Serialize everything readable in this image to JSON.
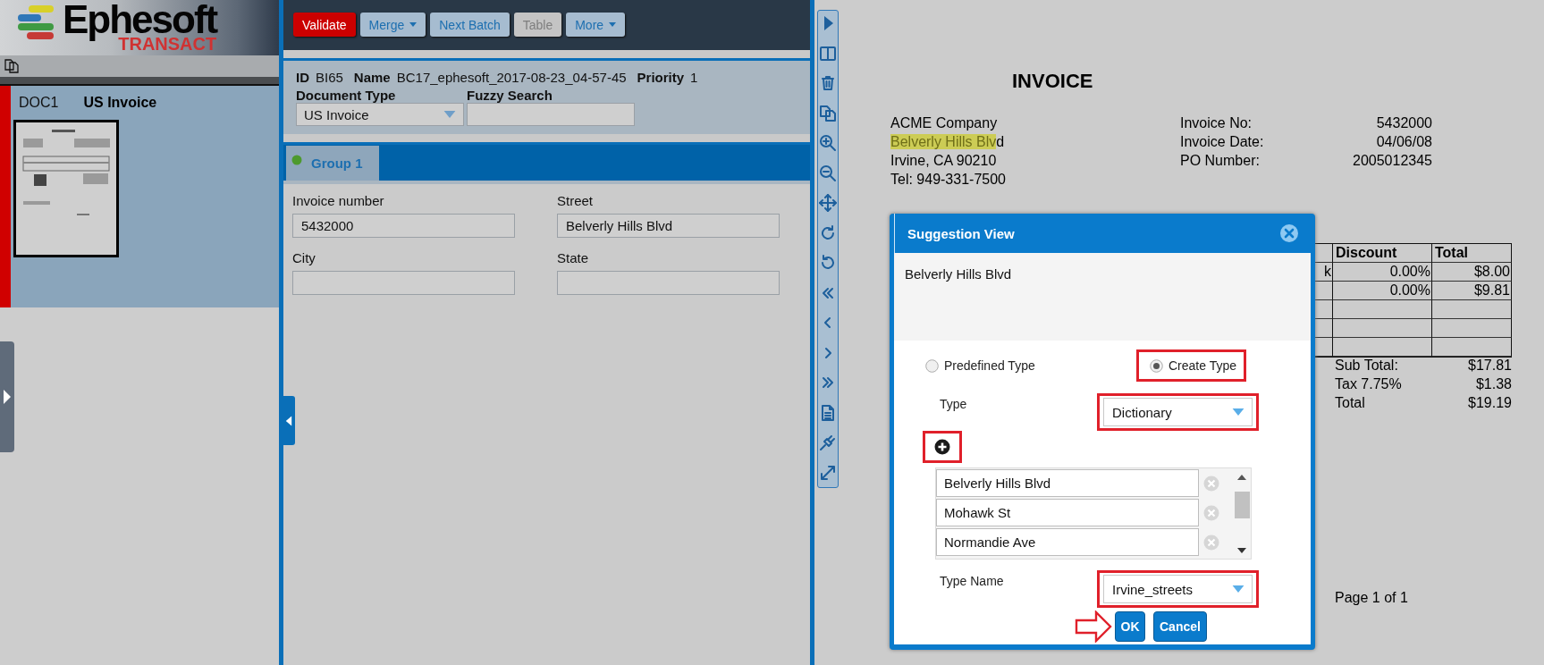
{
  "logo": {
    "name": "Ephesoft",
    "product": "TRANSACT"
  },
  "documents": [
    {
      "id": "DOC1",
      "type": "US Invoice",
      "selected": true
    }
  ],
  "toolbar": [
    {
      "label": "Validate",
      "kind": "primary",
      "disabled": false,
      "dropdown": false
    },
    {
      "label": "Merge",
      "kind": "normal",
      "disabled": false,
      "dropdown": true
    },
    {
      "label": "Next Batch",
      "kind": "normal",
      "disabled": false,
      "dropdown": false
    },
    {
      "label": "Table",
      "kind": "normal",
      "disabled": true,
      "dropdown": false
    },
    {
      "label": "More",
      "kind": "normal",
      "disabled": false,
      "dropdown": true
    }
  ],
  "batch_info": {
    "id_label": "ID",
    "id": "BI65",
    "name_label": "Name",
    "name": "BC17_ephesoft_2017-08-23_04-57-45",
    "priority_label": "Priority",
    "priority": "1",
    "document_type_label": "Document Type",
    "document_type": "US Invoice",
    "fuzzy_search_label": "Fuzzy Search"
  },
  "groups": [
    {
      "label": "Group 1",
      "selected": true
    }
  ],
  "fields": [
    {
      "label": "Invoice number",
      "value": "5432000"
    },
    {
      "label": "Street",
      "value": "Belverly Hills Blvd"
    },
    {
      "label": "City"
    },
    {
      "label": "State"
    }
  ],
  "invoice": {
    "title": "INVOICE",
    "address": [
      {
        "plain": "ACME Company"
      },
      {
        "highlighted": "Belverly Hills Blv",
        "plain": "d"
      },
      {
        "plain": "Irvine, CA 90210"
      },
      {
        "plain": "Tel: 949-331-7500"
      }
    ],
    "meta": [
      {
        "label": "Invoice No:",
        "value": "5432000"
      },
      {
        "label": "Invoice Date:",
        "value": "04/06/08"
      },
      {
        "label": "PO Number:",
        "value": "2005012345"
      }
    ],
    "table": {
      "columns": [
        null,
        "Discount",
        "Total"
      ],
      "rows": [
        [
          "k",
          "0.00%",
          "$8.00"
        ],
        [
          null,
          "0.00%",
          "$9.81"
        ],
        [
          null,
          null,
          null
        ],
        [
          null,
          null,
          null
        ],
        [
          null,
          null,
          null
        ]
      ]
    },
    "totals": [
      {
        "label": "Sub Total:",
        "value": "$17.81"
      },
      {
        "label": "Tax 7.75%",
        "value": "$1.38"
      },
      {
        "label": "Total",
        "value": "$19.19"
      }
    ],
    "page": "Page 1 of 1"
  },
  "dialog": {
    "title": "Suggestion View",
    "suggestion": "Belverly Hills Blvd",
    "options": [
      {
        "label": "Predefined Type",
        "selected": false,
        "annotated": false
      },
      {
        "label": "Create Type",
        "selected": true,
        "annotated": true
      }
    ],
    "type": {
      "label": "Type",
      "value": "Dictionary",
      "annotated": true
    },
    "add_annotated": true,
    "entries": [
      "Belverly Hills Blvd",
      "Mohawk St",
      "Normandie Ave"
    ],
    "type_name": {
      "label": "Type Name",
      "value": "Irvine_streets",
      "annotated": true
    },
    "buttons": [
      {
        "label": "OK",
        "kind": "ok",
        "pointed": true
      },
      {
        "label": "Cancel",
        "kind": "cancel",
        "pointed": false
      }
    ]
  }
}
